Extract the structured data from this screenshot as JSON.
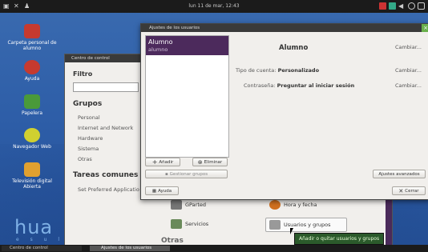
{
  "topbar": {
    "clock": "lun 11 de mar, 12:43"
  },
  "desktop": {
    "icons": [
      {
        "label": "Carpeta personal de alumno"
      },
      {
        "label": "Ayuda"
      },
      {
        "label": "Papelera"
      },
      {
        "label": "Navegador Web"
      },
      {
        "label": "Televisión digital Abierta"
      }
    ],
    "logo": "hua",
    "logo_sub": "e s u l l r"
  },
  "control_center": {
    "title": "Centro de control",
    "filter_label": "Filtro",
    "groups_title": "Grupos",
    "groups": [
      "Personal",
      "Internet and Network",
      "Hardware",
      "Sistema",
      "Otras"
    ],
    "tasks_title": "Tareas comunes",
    "tasks": [
      "Set Preferred Applicatio"
    ],
    "items": {
      "gparted": "GParted",
      "hora": "Hora y fecha",
      "servicios": "Servicios",
      "usuarios": "Usuarios y grupos"
    },
    "otras_section": "Otras",
    "tooltip": "Añadir o quitar usuarios y grupos"
  },
  "users_dialog": {
    "title": "Ajustes de los usuarios",
    "users": [
      {
        "name": "Alumno",
        "login": "alumno"
      }
    ],
    "selected_name": "Alumno",
    "change_label": "Cambiar...",
    "account_type_label": "Tipo de cuenta:",
    "account_type_value": "Personalizado",
    "password_label": "Contraseña:",
    "password_value": "Preguntar al iniciar sesión",
    "add_button": "Añadir",
    "delete_button": "Eliminar",
    "manage_groups_button": "Gestionar grupos",
    "advanced_button": "Ajustes avanzados",
    "help_button": "Ayuda",
    "close_button": "Cerrar"
  },
  "taskbar": {
    "items": [
      "Centro de control",
      "Ajustes de los usuarios"
    ]
  },
  "colors": {
    "accent_purple": "#4c2a5c",
    "desktop_blue": "#2d5da7",
    "tooltip_green": "#2b5a2b"
  }
}
